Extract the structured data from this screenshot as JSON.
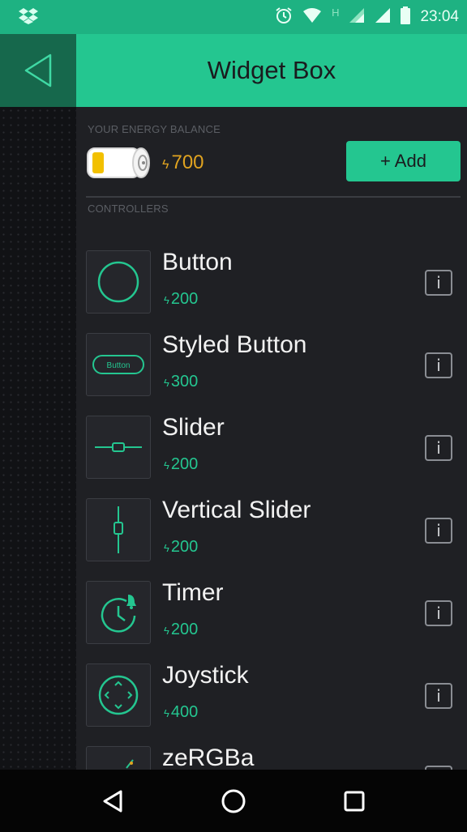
{
  "status_bar": {
    "time": "23:04",
    "network_letter": "H",
    "icons": [
      "dropbox-icon",
      "alarm-icon",
      "wifi-icon",
      "signal-icon",
      "signal-icon",
      "battery-icon"
    ]
  },
  "header": {
    "title": "Widget Box",
    "back_icon": "back-triangle-icon"
  },
  "energy": {
    "section_label": "YOUR ENERGY BALANCE",
    "currency_symbol": "ϟ",
    "amount": "700",
    "battery_icon": "energy-battery-icon",
    "add_label": "+ Add"
  },
  "controllers": {
    "section_label": "CONTROLLERS",
    "items": [
      {
        "name": "Button",
        "currency": "ϟ",
        "price": "200",
        "icon": "button-circle-icon"
      },
      {
        "name": "Styled Button",
        "currency": "ϟ",
        "price": "300",
        "icon": "styled-button-icon",
        "icon_text": "Button"
      },
      {
        "name": "Slider",
        "currency": "ϟ",
        "price": "200",
        "icon": "slider-icon"
      },
      {
        "name": "Vertical Slider",
        "currency": "ϟ",
        "price": "200",
        "icon": "vertical-slider-icon"
      },
      {
        "name": "Timer",
        "currency": "ϟ",
        "price": "200",
        "icon": "timer-icon"
      },
      {
        "name": "Joystick",
        "currency": "ϟ",
        "price": "400",
        "icon": "joystick-icon"
      },
      {
        "name": "zeRGBa",
        "icon": "zergba-icon"
      }
    ],
    "info_label": "i"
  },
  "nav_bar": {
    "back_icon": "nav-back-icon",
    "home_icon": "nav-home-icon",
    "recents_icon": "nav-recents-icon"
  },
  "colors": {
    "accent": "#24c690",
    "header_dark": "#16684c",
    "energy": "#e0a320",
    "panel": "#1f2024"
  }
}
